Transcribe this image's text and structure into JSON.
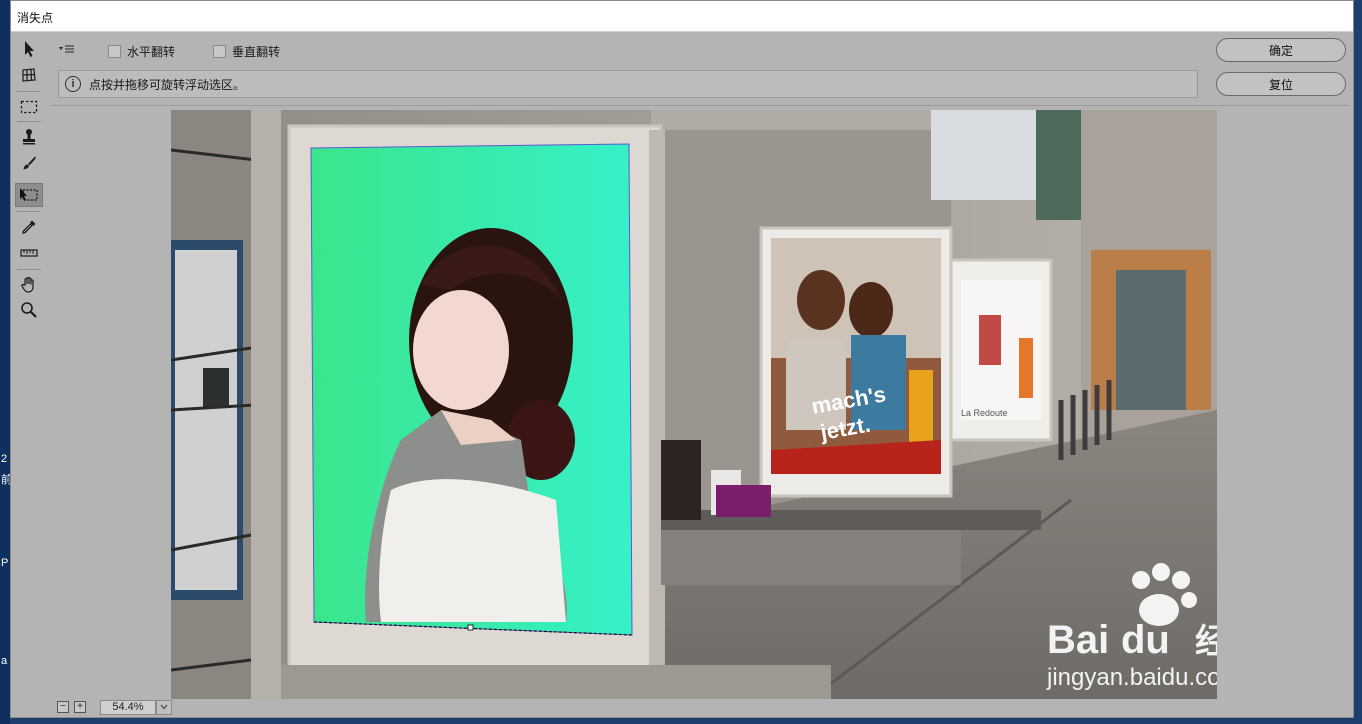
{
  "window": {
    "title": "消失点"
  },
  "desktop": {
    "edge_chars": [
      "2",
      "前",
      "P",
      "a"
    ]
  },
  "toolbar": {
    "tools": [
      {
        "name": "edit-plane-tool",
        "icon": "arrow-select-icon"
      },
      {
        "name": "create-plane-tool",
        "icon": "grid-plane-icon"
      },
      {
        "name": "marquee-tool",
        "icon": "marquee-icon"
      },
      {
        "name": "stamp-tool",
        "icon": "stamp-icon"
      },
      {
        "name": "brush-tool",
        "icon": "brush-icon"
      },
      {
        "name": "transform-tool",
        "icon": "transform-icon",
        "active": true
      },
      {
        "name": "eyedropper-tool",
        "icon": "eyedropper-icon"
      },
      {
        "name": "measure-tool",
        "icon": "ruler-icon"
      },
      {
        "name": "hand-tool",
        "icon": "hand-icon"
      },
      {
        "name": "zoom-tool",
        "icon": "zoom-icon"
      }
    ]
  },
  "options": {
    "flip_horizontal": "水平翻转",
    "flip_vertical": "垂直翻转",
    "info_text": "点按并拖移可旋转浮动选区。"
  },
  "buttons": {
    "ok": "确定",
    "reset": "复位"
  },
  "status": {
    "zoom": "54.4%",
    "zoom_out": "−",
    "zoom_in": "+"
  },
  "photo": {
    "poster_text_1": "mach's",
    "poster_text_2": "jetzt.",
    "poster_brand": "La Redoute",
    "watermark_brand_left": "Bai",
    "watermark_brand_right": "du",
    "watermark_cn": "经验",
    "watermark_url": "jingyan.baidu.com"
  },
  "colors": {
    "panel_bg": "#b4b4b4",
    "poster_green": "#39e6a7",
    "desktop": "#1d3f6e"
  }
}
